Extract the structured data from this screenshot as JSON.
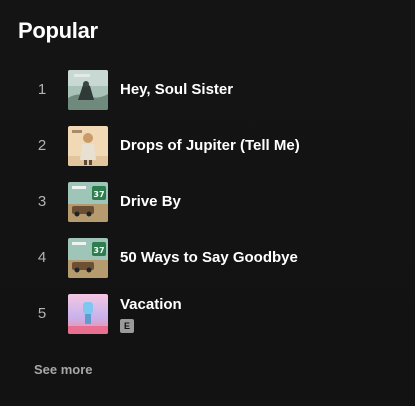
{
  "section": {
    "title": "Popular",
    "see_more_label": "See more"
  },
  "tracks": [
    {
      "number": "1",
      "title": "Hey, Soul Sister",
      "explicit": false
    },
    {
      "number": "2",
      "title": "Drops of Jupiter (Tell Me)",
      "explicit": false
    },
    {
      "number": "3",
      "title": "Drive By",
      "explicit": false
    },
    {
      "number": "4",
      "title": "50 Ways to Say Goodbye",
      "explicit": false
    },
    {
      "number": "5",
      "title": "Vacation",
      "explicit": true,
      "explicit_label": "E"
    }
  ],
  "colors": {
    "background": "#121212",
    "primary_text": "#ffffff",
    "secondary_text": "#b3b3b3",
    "badge": "#9a9a9a"
  }
}
